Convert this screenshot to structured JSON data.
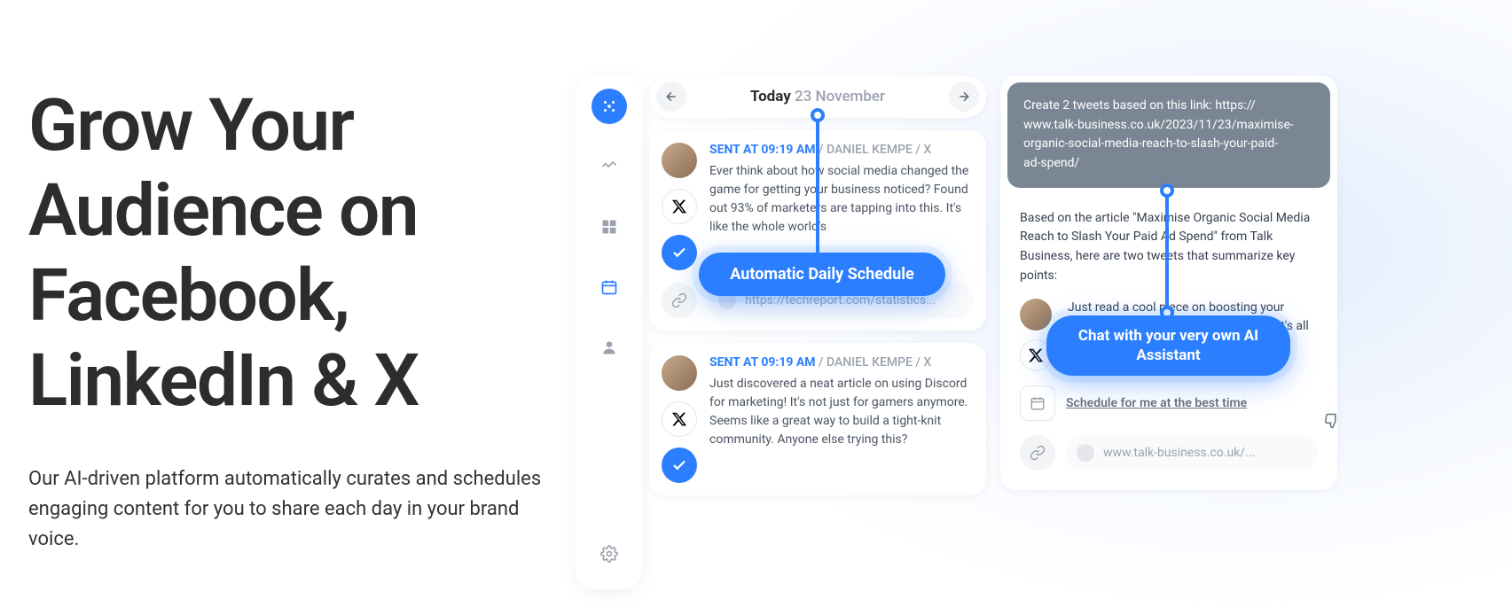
{
  "hero": {
    "title": "Grow Your Audience on Facebook, LinkedIn & X",
    "subtitle": "Our AI-driven platform automatically curates and schedules engaging content for you to share each day in your brand voice."
  },
  "dateBar": {
    "today": "Today",
    "date": "23 November"
  },
  "posts": [
    {
      "sent": "SENT AT 09:19 AM",
      "author": "DANIEL KEMPE / X",
      "text": "Ever think about how social media changed the game for getting your business noticed? Found out 93% of marketers are tapping into this. It's like the whole world's",
      "url": "https://techreport.com/statistics..."
    },
    {
      "sent": "SENT AT 09:19 AM",
      "author": "DANIEL KEMPE / X",
      "text": "Just discovered a neat article on using Discord for marketing! It's not just for gamers anymore. Seems like a great way to build a tight-knit community. Anyone else trying this?"
    }
  ],
  "chat": {
    "prompt": "Create 2 tweets based on this link: https://\nwww.talk-business.co.uk/2023/11/23/maximise-\norganic-social-media-reach-to-slash-your-paid-\nad-spend/",
    "responseIntro": "Based on the article \"Maximise Organic Social Media Reach to Slash Your Paid Ad Spend\" from Talk Business, here are two tweets that summarize key points:",
    "tweet": "Just read a cool piece on boosting your brand organically on social media. 🌿 It's all about cutting down on those pricey ads without losing your audience.",
    "scheduleLink": "Schedule for me at the best time",
    "sourceUrl": "www.talk-business.co.uk/..."
  },
  "pills": {
    "schedule": "Automatic Daily Schedule",
    "chat": "Chat with your very own AI Assistant"
  }
}
